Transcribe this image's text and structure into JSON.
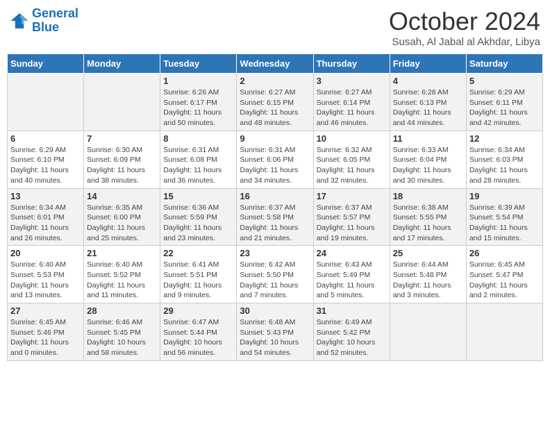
{
  "logo": {
    "line1": "General",
    "line2": "Blue"
  },
  "title": "October 2024",
  "subtitle": "Susah, Al Jabal al Akhdar, Libya",
  "days_header": [
    "Sunday",
    "Monday",
    "Tuesday",
    "Wednesday",
    "Thursday",
    "Friday",
    "Saturday"
  ],
  "weeks": [
    [
      {
        "day": "",
        "info": ""
      },
      {
        "day": "",
        "info": ""
      },
      {
        "day": "1",
        "sunrise": "6:26 AM",
        "sunset": "6:17 PM",
        "daylight": "11 hours and 50 minutes."
      },
      {
        "day": "2",
        "sunrise": "6:27 AM",
        "sunset": "6:15 PM",
        "daylight": "11 hours and 48 minutes."
      },
      {
        "day": "3",
        "sunrise": "6:27 AM",
        "sunset": "6:14 PM",
        "daylight": "11 hours and 46 minutes."
      },
      {
        "day": "4",
        "sunrise": "6:28 AM",
        "sunset": "6:13 PM",
        "daylight": "11 hours and 44 minutes."
      },
      {
        "day": "5",
        "sunrise": "6:29 AM",
        "sunset": "6:11 PM",
        "daylight": "11 hours and 42 minutes."
      }
    ],
    [
      {
        "day": "6",
        "sunrise": "6:29 AM",
        "sunset": "6:10 PM",
        "daylight": "11 hours and 40 minutes."
      },
      {
        "day": "7",
        "sunrise": "6:30 AM",
        "sunset": "6:09 PM",
        "daylight": "11 hours and 38 minutes."
      },
      {
        "day": "8",
        "sunrise": "6:31 AM",
        "sunset": "6:08 PM",
        "daylight": "11 hours and 36 minutes."
      },
      {
        "day": "9",
        "sunrise": "6:31 AM",
        "sunset": "6:06 PM",
        "daylight": "11 hours and 34 minutes."
      },
      {
        "day": "10",
        "sunrise": "6:32 AM",
        "sunset": "6:05 PM",
        "daylight": "11 hours and 32 minutes."
      },
      {
        "day": "11",
        "sunrise": "6:33 AM",
        "sunset": "6:04 PM",
        "daylight": "11 hours and 30 minutes."
      },
      {
        "day": "12",
        "sunrise": "6:34 AM",
        "sunset": "6:03 PM",
        "daylight": "11 hours and 28 minutes."
      }
    ],
    [
      {
        "day": "13",
        "sunrise": "6:34 AM",
        "sunset": "6:01 PM",
        "daylight": "11 hours and 26 minutes."
      },
      {
        "day": "14",
        "sunrise": "6:35 AM",
        "sunset": "6:00 PM",
        "daylight": "11 hours and 25 minutes."
      },
      {
        "day": "15",
        "sunrise": "6:36 AM",
        "sunset": "5:59 PM",
        "daylight": "11 hours and 23 minutes."
      },
      {
        "day": "16",
        "sunrise": "6:37 AM",
        "sunset": "5:58 PM",
        "daylight": "11 hours and 21 minutes."
      },
      {
        "day": "17",
        "sunrise": "6:37 AM",
        "sunset": "5:57 PM",
        "daylight": "11 hours and 19 minutes."
      },
      {
        "day": "18",
        "sunrise": "6:38 AM",
        "sunset": "5:55 PM",
        "daylight": "11 hours and 17 minutes."
      },
      {
        "day": "19",
        "sunrise": "6:39 AM",
        "sunset": "5:54 PM",
        "daylight": "11 hours and 15 minutes."
      }
    ],
    [
      {
        "day": "20",
        "sunrise": "6:40 AM",
        "sunset": "5:53 PM",
        "daylight": "11 hours and 13 minutes."
      },
      {
        "day": "21",
        "sunrise": "6:40 AM",
        "sunset": "5:52 PM",
        "daylight": "11 hours and 11 minutes."
      },
      {
        "day": "22",
        "sunrise": "6:41 AM",
        "sunset": "5:51 PM",
        "daylight": "11 hours and 9 minutes."
      },
      {
        "day": "23",
        "sunrise": "6:42 AM",
        "sunset": "5:50 PM",
        "daylight": "11 hours and 7 minutes."
      },
      {
        "day": "24",
        "sunrise": "6:43 AM",
        "sunset": "5:49 PM",
        "daylight": "11 hours and 5 minutes."
      },
      {
        "day": "25",
        "sunrise": "6:44 AM",
        "sunset": "5:48 PM",
        "daylight": "11 hours and 3 minutes."
      },
      {
        "day": "26",
        "sunrise": "6:45 AM",
        "sunset": "5:47 PM",
        "daylight": "11 hours and 2 minutes."
      }
    ],
    [
      {
        "day": "27",
        "sunrise": "6:45 AM",
        "sunset": "5:46 PM",
        "daylight": "11 hours and 0 minutes."
      },
      {
        "day": "28",
        "sunrise": "6:46 AM",
        "sunset": "5:45 PM",
        "daylight": "10 hours and 58 minutes."
      },
      {
        "day": "29",
        "sunrise": "6:47 AM",
        "sunset": "5:44 PM",
        "daylight": "10 hours and 56 minutes."
      },
      {
        "day": "30",
        "sunrise": "6:48 AM",
        "sunset": "5:43 PM",
        "daylight": "10 hours and 54 minutes."
      },
      {
        "day": "31",
        "sunrise": "6:49 AM",
        "sunset": "5:42 PM",
        "daylight": "10 hours and 52 minutes."
      },
      {
        "day": "",
        "info": ""
      },
      {
        "day": "",
        "info": ""
      }
    ]
  ]
}
